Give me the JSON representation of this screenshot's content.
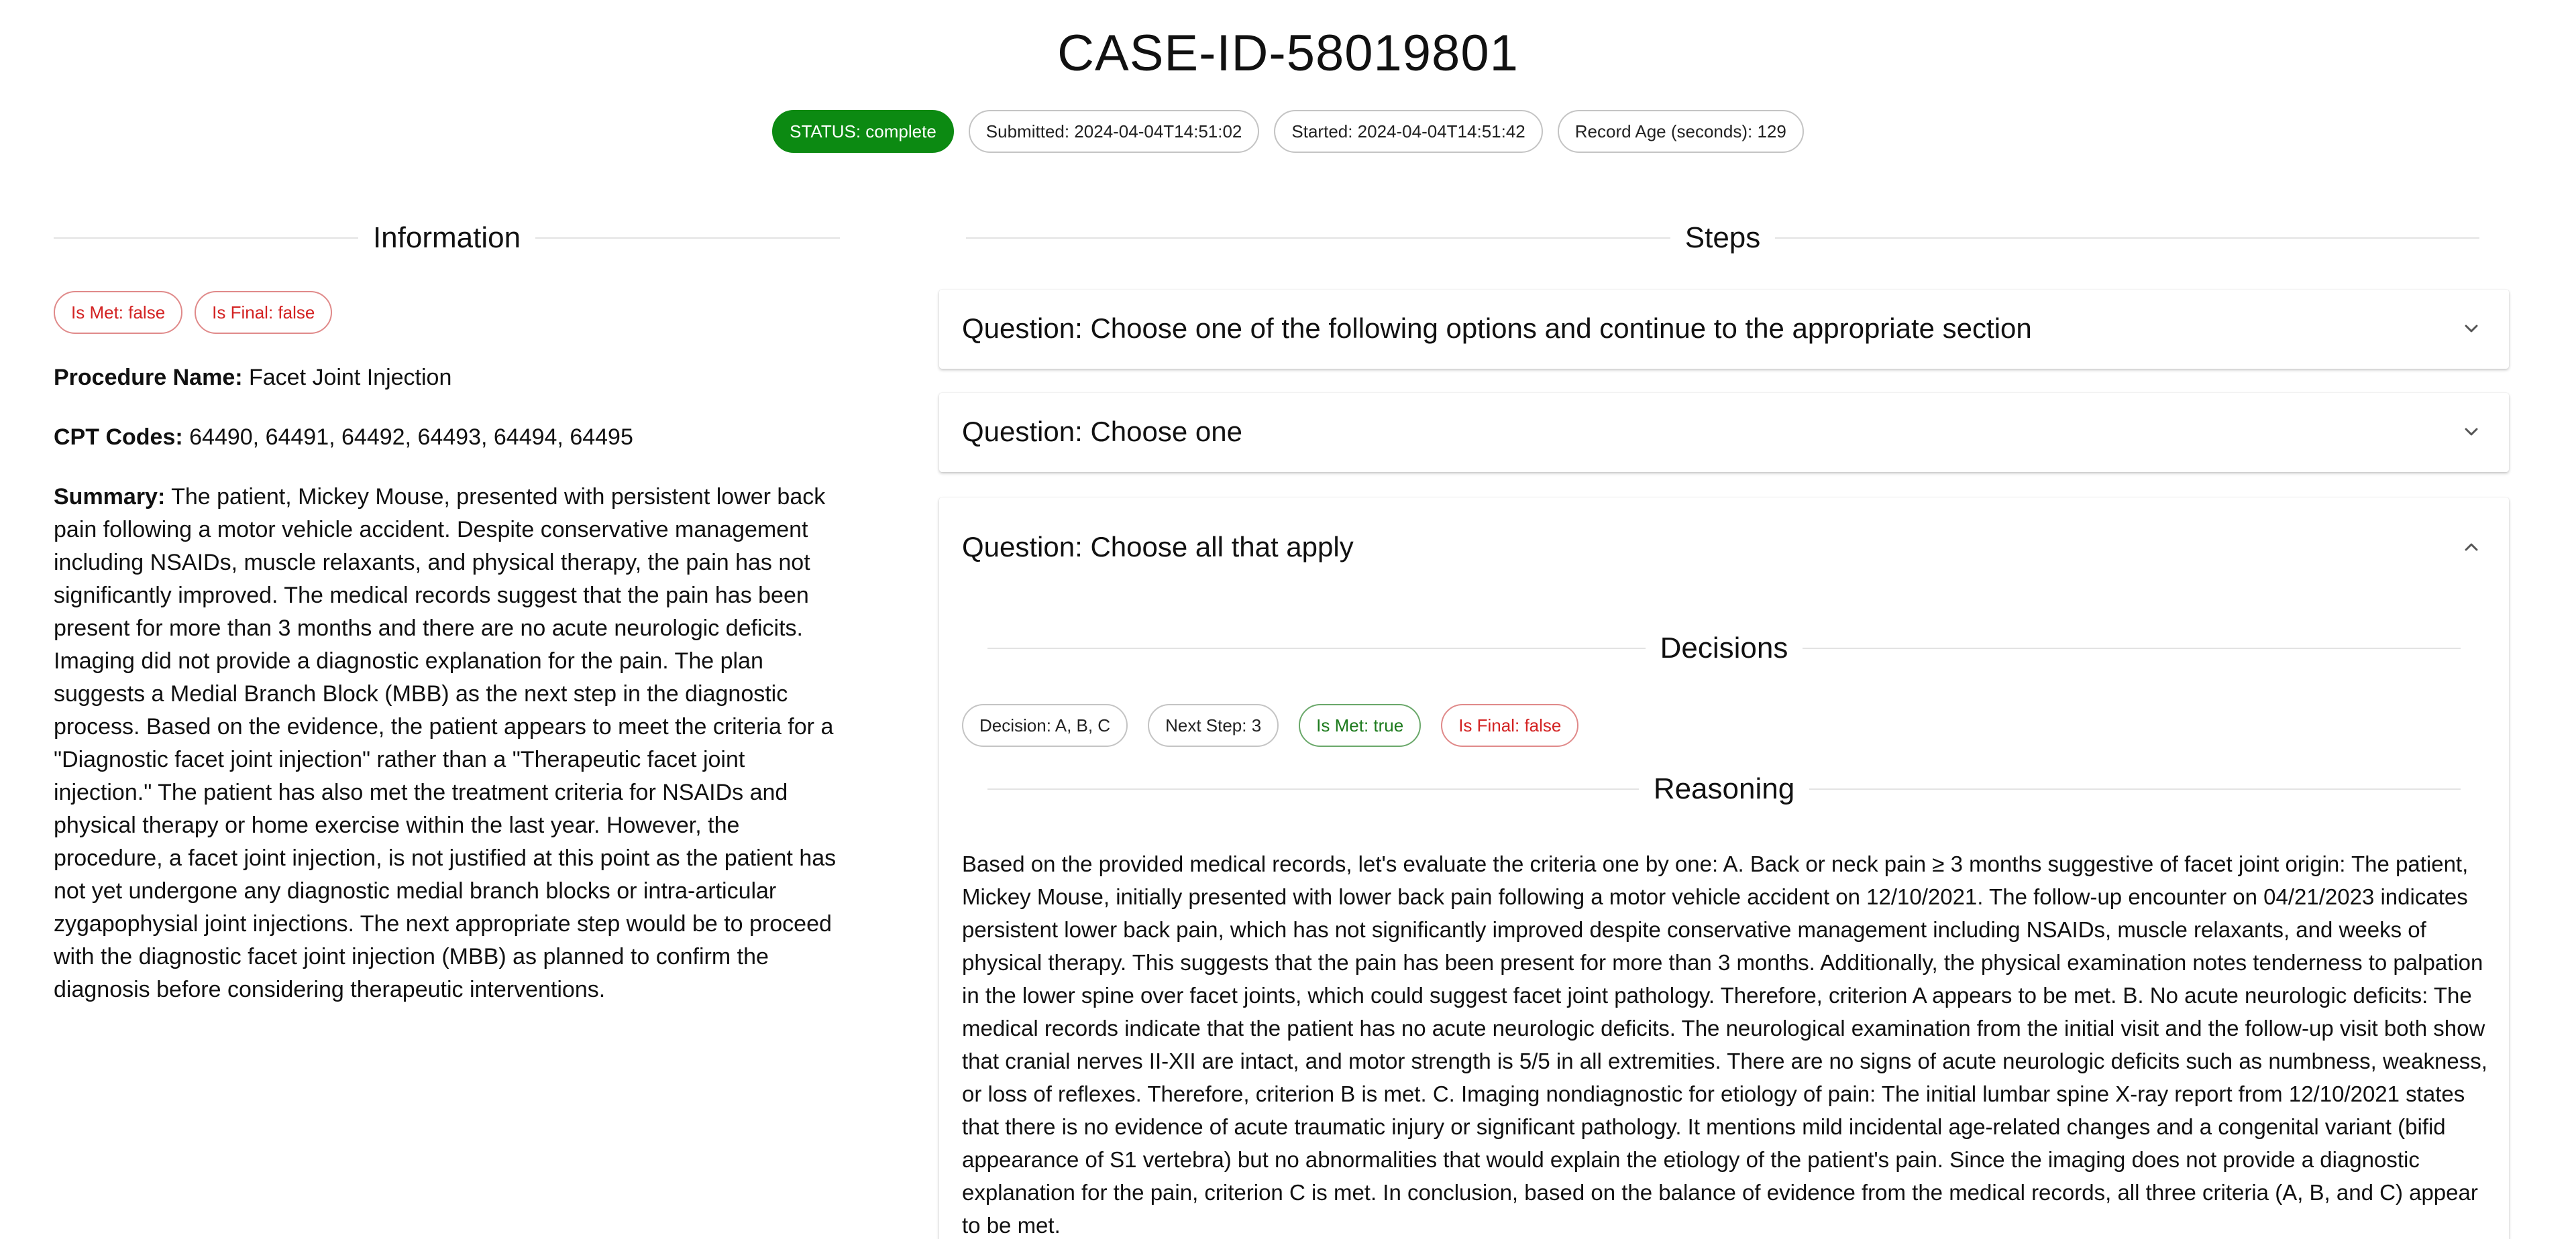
{
  "case_id": "CASE-ID-58019801",
  "top_chips": {
    "status": "STATUS: complete",
    "submitted": "Submitted: 2024-04-04T14:51:02",
    "started": "Started: 2024-04-04T14:51:42",
    "record_age": "Record Age (seconds): 129"
  },
  "information": {
    "heading": "Information",
    "is_met": "Is Met: false",
    "is_final": "Is Final: false",
    "procedure_label": "Procedure Name:",
    "procedure_value": " Facet Joint Injection",
    "cpt_label": "CPT Codes:",
    "cpt_value": " 64490, 64491, 64492, 64493, 64494, 64495",
    "summary_label": "Summary:",
    "summary_value": " The patient, Mickey Mouse, presented with persistent lower back pain following a motor vehicle accident. Despite conservative management including NSAIDs, muscle relaxants, and physical therapy, the pain has not significantly improved. The medical records suggest that the pain has been present for more than 3 months and there are no acute neurologic deficits. Imaging did not provide a diagnostic explanation for the pain. The plan suggests a Medial Branch Block (MBB) as the next step in the diagnostic process. Based on the evidence, the patient appears to meet the criteria for a \"Diagnostic facet joint injection\" rather than a \"Therapeutic facet joint injection.\" The patient has also met the treatment criteria for NSAIDs and physical therapy or home exercise within the last year. However, the procedure, a facet joint injection, is not justified at this point as the patient has not yet undergone any diagnostic medial branch blocks or intra-articular zygapophysial joint injections. The next appropriate step would be to proceed with the diagnostic facet joint injection (MBB) as planned to confirm the diagnosis before considering therapeutic interventions."
  },
  "steps": {
    "heading": "Steps",
    "questions": [
      {
        "label": "Question: Choose one of the following options and continue to the appropriate section",
        "expanded": false
      },
      {
        "label": "Question: Choose one",
        "expanded": false
      },
      {
        "label": "Question: Choose all that apply",
        "expanded": true
      }
    ],
    "decisions_heading": "Decisions",
    "decision": "Decision: A, B, C",
    "next_step": "Next Step: 3",
    "is_met": "Is Met: true",
    "is_final": "Is Final: false",
    "reasoning_heading": "Reasoning",
    "reasoning": "Based on the provided medical records, let's evaluate the criteria one by one: A. Back or neck pain ≥ 3 months suggestive of facet joint origin: The patient, Mickey Mouse, initially presented with lower back pain following a motor vehicle accident on 12/10/2021. The follow-up encounter on 04/21/2023 indicates persistent lower back pain, which has not significantly improved despite conservative management including NSAIDs, muscle relaxants, and weeks of physical therapy. This suggests that the pain has been present for more than 3 months. Additionally, the physical examination notes tenderness to palpation in the lower spine over facet joints, which could suggest facet joint pathology. Therefore, criterion A appears to be met. B. No acute neurologic deficits: The medical records indicate that the patient has no acute neurologic deficits. The neurological examination from the initial visit and the follow-up visit both show that cranial nerves II-XII are intact, and motor strength is 5/5 in all extremities. There are no signs of acute neurologic deficits such as numbness, weakness, or loss of reflexes. Therefore, criterion B is met. C. Imaging nondiagnostic for etiology of pain: The initial lumbar spine X-ray report from 12/10/2021 states that there is no evidence of acute traumatic injury or significant pathology. It mentions mild incidental age-related changes and a congenital variant (bifid appearance of S1 vertebra) but no abnormalities that would explain the etiology of the patient's pain. Since the imaging does not provide a diagnostic explanation for the pain, criterion C is met. In conclusion, based on the balance of evidence from the medical records, all three criteria (A, B, and C) appear to be met."
  },
  "colors": {
    "status_green": "#0c8a12",
    "false_red": "#d32222",
    "true_green": "#1c7a1c"
  }
}
